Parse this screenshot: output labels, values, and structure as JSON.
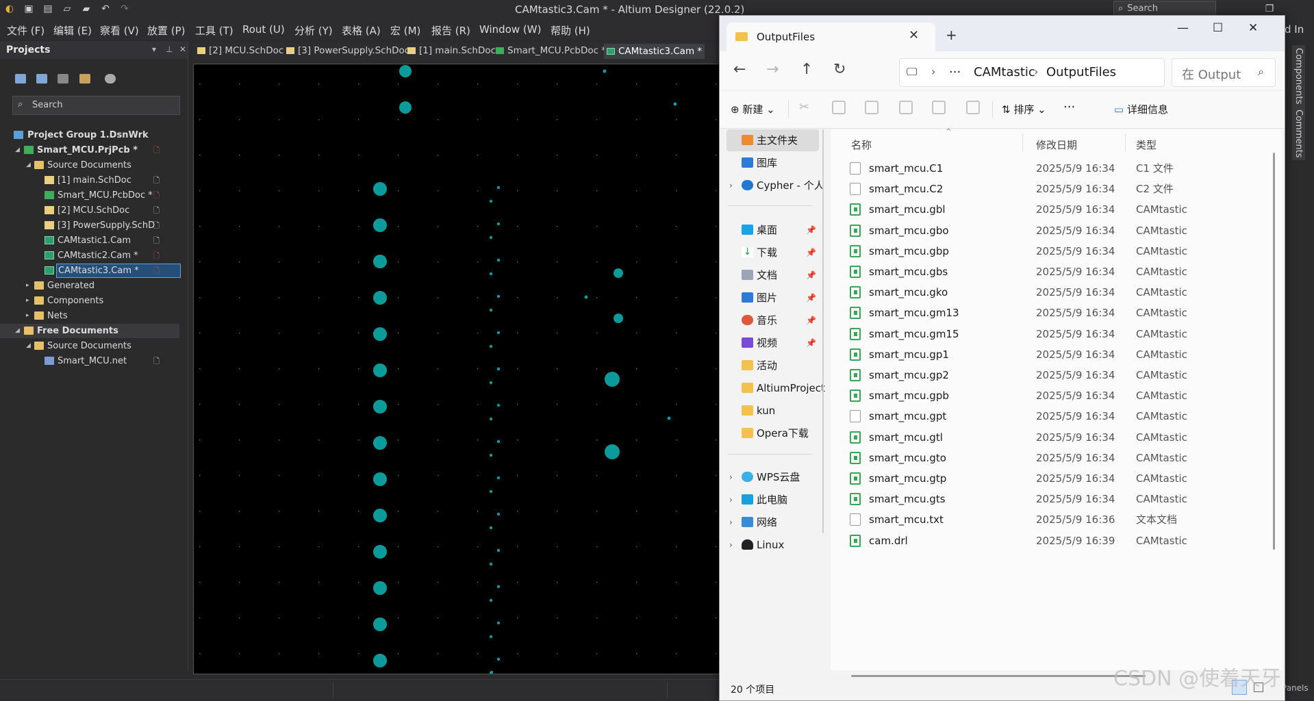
{
  "app": {
    "title": "CAMtastic3.Cam * - Altium Designer (22.0.2)",
    "search_label": "Search",
    "menu": [
      "文件 (F)",
      "编辑 (E)",
      "察看 (V)",
      "放置 (P)",
      "工具 (T)",
      "Rout (U)",
      "分析 (Y)",
      "表格 (A)",
      "宏 (M)",
      "报告 (R)",
      "Window (W)",
      "帮助 (H)"
    ],
    "menu_overflow": "d In",
    "panels_label": "Panels"
  },
  "projects": {
    "title": "Projects",
    "search_placeholder": "Search",
    "tree": [
      {
        "label": "Project Group 1.DsnWrk",
        "bold": true
      },
      {
        "label": "Smart_MCU.PrjPcb *",
        "bold": true
      },
      {
        "label": "Source Documents"
      },
      {
        "label": "[1] main.SchDoc"
      },
      {
        "label": "Smart_MCU.PcbDoc *"
      },
      {
        "label": "[2] MCU.SchDoc"
      },
      {
        "label": "[3] PowerSupply.SchD"
      },
      {
        "label": "CAMtastic1.Cam"
      },
      {
        "label": "CAMtastic2.Cam *"
      },
      {
        "label": "CAMtastic3.Cam *"
      },
      {
        "label": "Generated"
      },
      {
        "label": "Components"
      },
      {
        "label": "Nets"
      },
      {
        "label": "Free Documents",
        "bold": true
      },
      {
        "label": "Source Documents"
      },
      {
        "label": "Smart_MCU.net"
      }
    ]
  },
  "tabs": [
    "[2] MCU.SchDoc",
    "[3] PowerSupply.SchDoc",
    "[1] main.SchDoc",
    "Smart_MCU.PcbDoc *",
    "CAMtastic3.Cam *"
  ],
  "side_tabs": [
    "Components",
    "Comments"
  ],
  "explorer": {
    "tab_title": "OutputFiles",
    "address": [
      "CAMtastic",
      "OutputFiles"
    ],
    "address_more": "···",
    "search_placeholder": "在 Output",
    "commands": {
      "new": "新建",
      "sort": "排序",
      "more": "···",
      "details": "详细信息"
    },
    "nav": {
      "home": "主文件夹",
      "gallery": "图库",
      "cloud": "Cypher - 个人",
      "desktop": "桌面",
      "downloads": "下载",
      "documents": "文档",
      "pictures": "图片",
      "music": "音乐",
      "videos": "视频",
      "activities": "活动",
      "altium": "AltiumProject",
      "kun": "kun",
      "opera": "Opera下载",
      "wps": "WPS云盘",
      "pc": "此电脑",
      "network": "网络",
      "linux": "Linux"
    },
    "columns": {
      "name": "名称",
      "date": "修改日期",
      "type": "类型"
    },
    "files": [
      {
        "name": "smart_mcu.C1",
        "date": "2025/5/9 16:34",
        "type": "C1 文件",
        "icon": "blank"
      },
      {
        "name": "smart_mcu.C2",
        "date": "2025/5/9 16:34",
        "type": "C2 文件",
        "icon": "blank"
      },
      {
        "name": "smart_mcu.gbl",
        "date": "2025/5/9 16:34",
        "type": "CAMtastic",
        "icon": "gerber"
      },
      {
        "name": "smart_mcu.gbo",
        "date": "2025/5/9 16:34",
        "type": "CAMtastic",
        "icon": "gerber"
      },
      {
        "name": "smart_mcu.gbp",
        "date": "2025/5/9 16:34",
        "type": "CAMtastic",
        "icon": "gerber"
      },
      {
        "name": "smart_mcu.gbs",
        "date": "2025/5/9 16:34",
        "type": "CAMtastic",
        "icon": "gerber"
      },
      {
        "name": "smart_mcu.gko",
        "date": "2025/5/9 16:34",
        "type": "CAMtastic",
        "icon": "gerber"
      },
      {
        "name": "smart_mcu.gm13",
        "date": "2025/5/9 16:34",
        "type": "CAMtastic",
        "icon": "gerber"
      },
      {
        "name": "smart_mcu.gm15",
        "date": "2025/5/9 16:34",
        "type": "CAMtastic",
        "icon": "gerber"
      },
      {
        "name": "smart_mcu.gp1",
        "date": "2025/5/9 16:34",
        "type": "CAMtastic",
        "icon": "gerber"
      },
      {
        "name": "smart_mcu.gp2",
        "date": "2025/5/9 16:34",
        "type": "CAMtastic",
        "icon": "gerber"
      },
      {
        "name": "smart_mcu.gpb",
        "date": "2025/5/9 16:34",
        "type": "CAMtastic",
        "icon": "gerber"
      },
      {
        "name": "smart_mcu.gpt",
        "date": "2025/5/9 16:34",
        "type": "CAMtastic",
        "icon": "blank"
      },
      {
        "name": "smart_mcu.gtl",
        "date": "2025/5/9 16:34",
        "type": "CAMtastic",
        "icon": "gerber"
      },
      {
        "name": "smart_mcu.gto",
        "date": "2025/5/9 16:34",
        "type": "CAMtastic",
        "icon": "gerber"
      },
      {
        "name": "smart_mcu.gtp",
        "date": "2025/5/9 16:34",
        "type": "CAMtastic",
        "icon": "gerber"
      },
      {
        "name": "smart_mcu.gts",
        "date": "2025/5/9 16:34",
        "type": "CAMtastic",
        "icon": "gerber"
      },
      {
        "name": "smart_mcu.txt",
        "date": "2025/5/9 16:36",
        "type": "文本文档",
        "icon": "txt"
      },
      {
        "name": "cam.drl",
        "date": "2025/5/9 16:39",
        "type": "CAMtastic",
        "icon": "gerber"
      }
    ],
    "status": "20 个项目"
  },
  "watermark": "CSDN @使着天牙",
  "colors": {
    "pad": "#0b9b9b",
    "canvas": "#000000",
    "accent": "#3fae5a"
  }
}
